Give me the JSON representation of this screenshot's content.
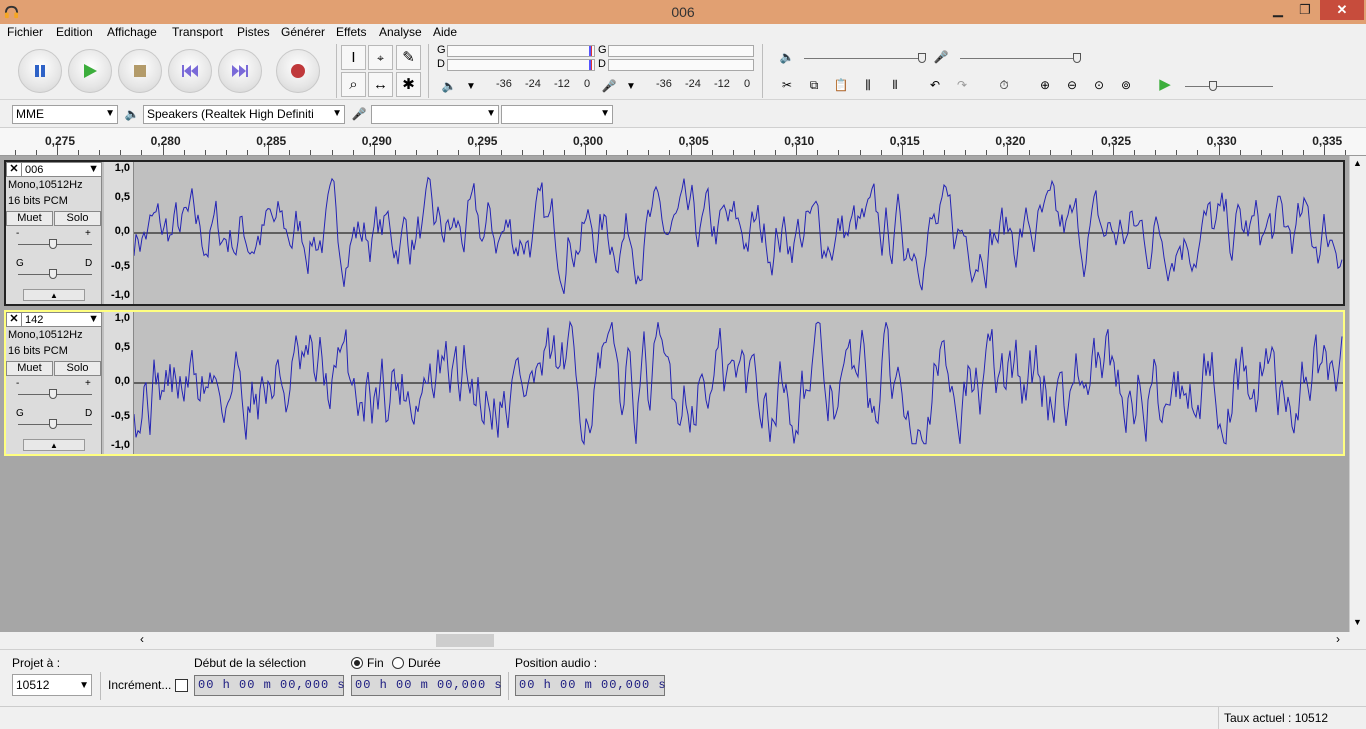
{
  "window": {
    "title": "006",
    "minimize": "▁",
    "maximize": "❐",
    "close": "✕"
  },
  "menu": [
    "Fichier",
    "Edition",
    "Affichage",
    "Transport",
    "Pistes",
    "Générer",
    "Effets",
    "Analyse",
    "Aide"
  ],
  "meters": {
    "left_label": "G",
    "right_label": "D",
    "ticks": [
      "-36",
      "-24",
      "-12",
      "0"
    ]
  },
  "device": {
    "host": "MME",
    "output": "Speakers (Realtek High Definiti",
    "input": "",
    "channels": ""
  },
  "ruler": [
    "0,275",
    "0,280",
    "0,285",
    "0,290",
    "0,295",
    "0,300",
    "0,305",
    "0,310",
    "0,315",
    "0,320",
    "0,325",
    "0,330",
    "0,335"
  ],
  "tracks": [
    {
      "name": "006",
      "format": "Mono,10512Hz",
      "bits": "16 bits PCM",
      "mute": "Muet",
      "solo": "Solo",
      "gain_left": "-",
      "gain_right": "+",
      "pan_left": "G",
      "pan_right": "D",
      "scale": [
        "1,0",
        "0,5",
        "0,0",
        "-0,5",
        "-1,0"
      ],
      "selected": false
    },
    {
      "name": "142",
      "format": "Mono,10512Hz",
      "bits": "16 bits PCM",
      "mute": "Muet",
      "solo": "Solo",
      "gain_left": "-",
      "gain_right": "+",
      "pan_left": "G",
      "pan_right": "D",
      "scale": [
        "1,0",
        "0,5",
        "0,0",
        "-0,5",
        "-1,0"
      ],
      "selected": true
    }
  ],
  "bottom": {
    "project_rate_label": "Projet à :",
    "project_rate": "10512",
    "snap_label": "Incrément...",
    "selection_start_label": "Début de la sélection",
    "end_label": "Fin",
    "length_label": "Durée",
    "audio_position_label": "Position audio :",
    "start_time": "00 h 00 m 00,000 s",
    "end_time": "00 h 00 m 00,000 s",
    "position_time": "00 h 00 m 00,000 s"
  },
  "status": {
    "rate": "Taux actuel : 10512"
  },
  "colors": {
    "titlebar": "#e1a072",
    "waveform": "#2323b4",
    "play": "#3cae3c",
    "record": "#c0393b",
    "pause": "#2e62c7"
  }
}
